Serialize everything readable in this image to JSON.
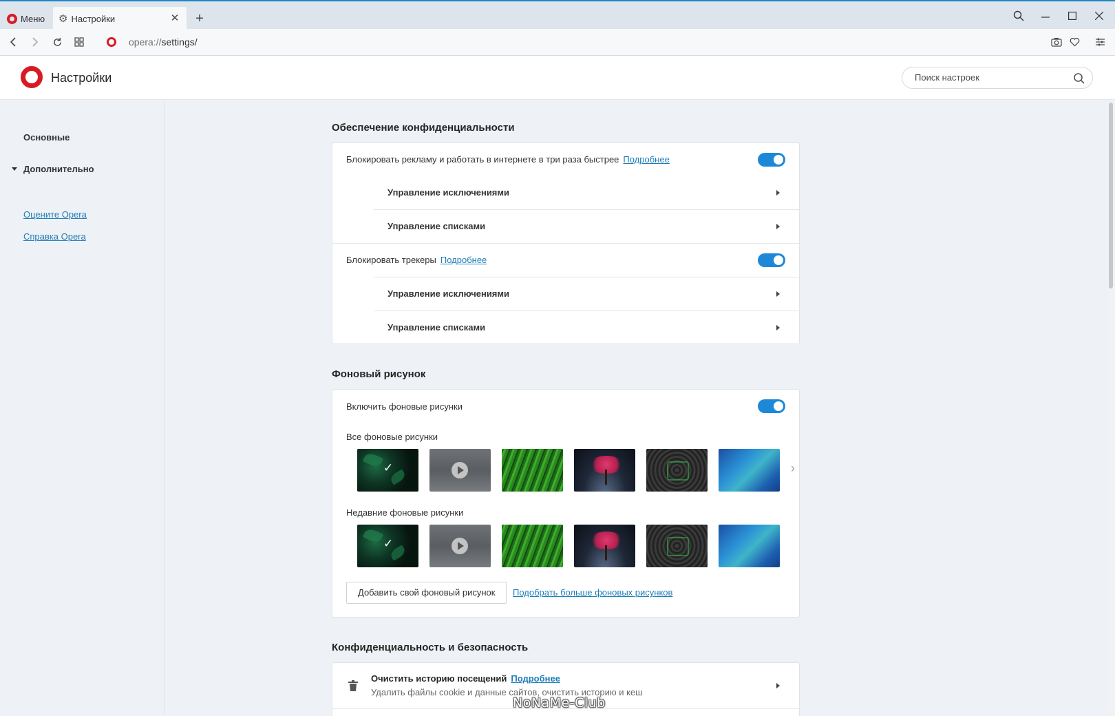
{
  "tabs": {
    "menu_label": "Меню",
    "settings_label": "Настройки",
    "close_symbol": "✕",
    "new_tab_symbol": "+"
  },
  "address": {
    "scheme": "opera://",
    "path": "settings/"
  },
  "header": {
    "title": "Настройки",
    "search_placeholder": "Поиск настроек"
  },
  "sidebar": {
    "basic": "Основные",
    "advanced": "Дополнительно",
    "rate_opera": "Оцените Opera",
    "opera_help": "Справка Opera"
  },
  "privacy_protection": {
    "title": "Обеспечение конфиденциальности",
    "block_ads_label": "Блокировать рекламу и работать в интернете в три раза быстрее",
    "block_ads_link": "Подробнее",
    "block_ads_enabled": true,
    "manage_exceptions": "Управление исключениями",
    "manage_lists": "Управление списками",
    "block_trackers_label": "Блокировать трекеры",
    "block_trackers_link": "Подробнее",
    "block_trackers_enabled": true,
    "manage_exceptions_2": "Управление исключениями",
    "manage_lists_2": "Управление списками"
  },
  "wallpaper": {
    "title": "Фоновый рисунок",
    "enable_label": "Включить фоновые рисунки",
    "enable_enabled": true,
    "all_label": "Все фоновые рисунки",
    "recent_label": "Недавние фоновые рисунки",
    "add_button": "Добавить свой фоновый рисунок",
    "more_link": "Подобрать больше фоновых рисунков",
    "thumbnails": [
      "green-leaves-selected",
      "rainy-glass-video",
      "green-grass",
      "pink-tree-night",
      "hex-pattern-green",
      "blue-abstract"
    ],
    "check_symbol": "✓",
    "next_symbol": "›"
  },
  "privacy_security": {
    "title": "Конфиденциальность и безопасность",
    "clear_history_title": "Очистить историю посещений",
    "clear_history_link": "Подробнее",
    "clear_history_desc": "Удалить файлы cookie и данные сайтов, очистить историю и кеш"
  },
  "watermark": "NoNaMe-Club",
  "colors": {
    "opera_red": "#d81b22",
    "accent_blue": "#1e88d8",
    "link_blue": "#1e7db8"
  }
}
